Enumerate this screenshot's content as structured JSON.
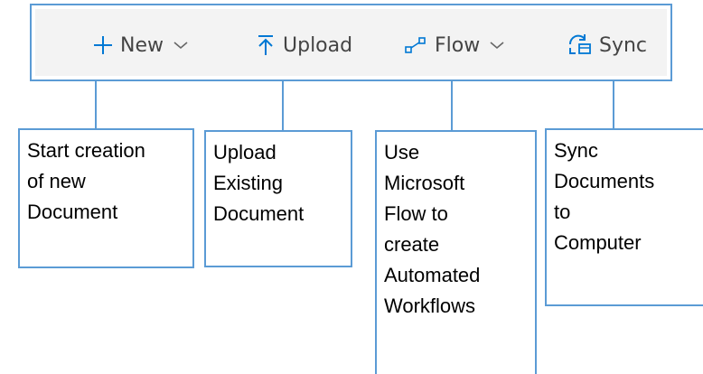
{
  "toolbar": {
    "new_label": "New",
    "upload_label": "Upload",
    "flow_label": "Flow",
    "sync_label": "Sync",
    "icons": {
      "new": "plus-icon",
      "upload": "upload-arrow-icon",
      "flow": "flow-icon",
      "sync": "sync-icon",
      "dropdown": "chevron-down-icon"
    }
  },
  "callouts": {
    "new": [
      "Start creation",
      "of new",
      "Document"
    ],
    "upload": [
      "Upload",
      "Existing",
      "Document"
    ],
    "flow": [
      "Use",
      "Microsoft",
      "Flow to",
      "create",
      "Automated",
      "Workflows"
    ],
    "sync": [
      "Sync",
      "Documents",
      "to",
      "Computer"
    ]
  },
  "colors": {
    "accent_blue": "#0078d4",
    "border_blue": "#5b9bd5",
    "toolbar_bg": "#f3f3f3",
    "text": "#444444"
  }
}
